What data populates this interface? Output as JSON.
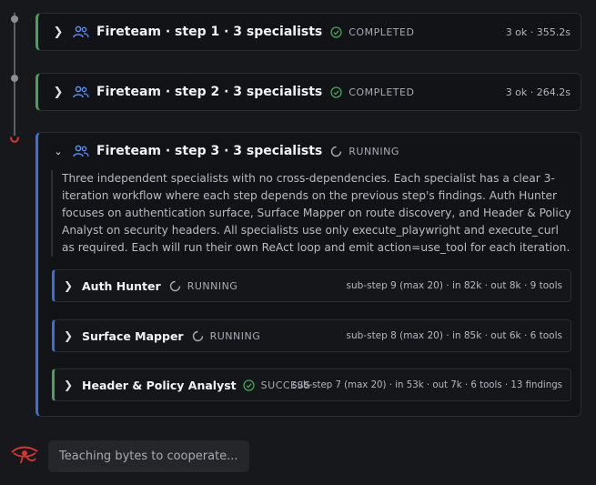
{
  "steps": [
    {
      "title": "Fireteam · step 1 · 3 specialists",
      "status": "COMPLETED",
      "meta": "3 ok · 355.2s"
    },
    {
      "title": "Fireteam · step 2 · 3 specialists",
      "status": "COMPLETED",
      "meta": "3 ok · 264.2s"
    },
    {
      "title": "Fireteam · step 3 · 3 specialists",
      "status": "RUNNING",
      "description": "Three independent specialists with no cross-dependencies. Each specialist has a clear 3-iteration workflow where each step depends on the previous step's findings. Auth Hunter focuses on authentication surface, Surface Mapper on route discovery, and Header & Policy Analyst on security headers. All specialists use only execute_playwright and execute_curl as required. Each will run their own ReAct loop and emit action=use_tool for each iteration.",
      "specialists": [
        {
          "name": "Auth Hunter",
          "status": "RUNNING",
          "meta": "sub-step 9 (max 20) · in 82k · out 8k · 9 tools"
        },
        {
          "name": "Surface Mapper",
          "status": "RUNNING",
          "meta": "sub-step 8 (max 20) · in 85k · out 6k · 6 tools"
        },
        {
          "name": "Header & Policy Analyst",
          "status": "SUCCESS",
          "meta": "sub-step 7 (max 20) · in 53k · out 7k · 6 tools · 13 findings"
        }
      ]
    }
  ],
  "footer": {
    "message": "Teaching bytes to cooperate..."
  },
  "colors": {
    "success": "#47a25a",
    "running": "#3b6fd6",
    "accent_red": "#d8342f",
    "team_icon": "#5b8def"
  },
  "icons": {
    "team": "people-icon",
    "completed": "check-circle-icon",
    "running": "spinner-icon",
    "expand": "chevron-right-icon",
    "collapse": "chevron-down-icon",
    "logo": "eye-of-ra-icon"
  }
}
